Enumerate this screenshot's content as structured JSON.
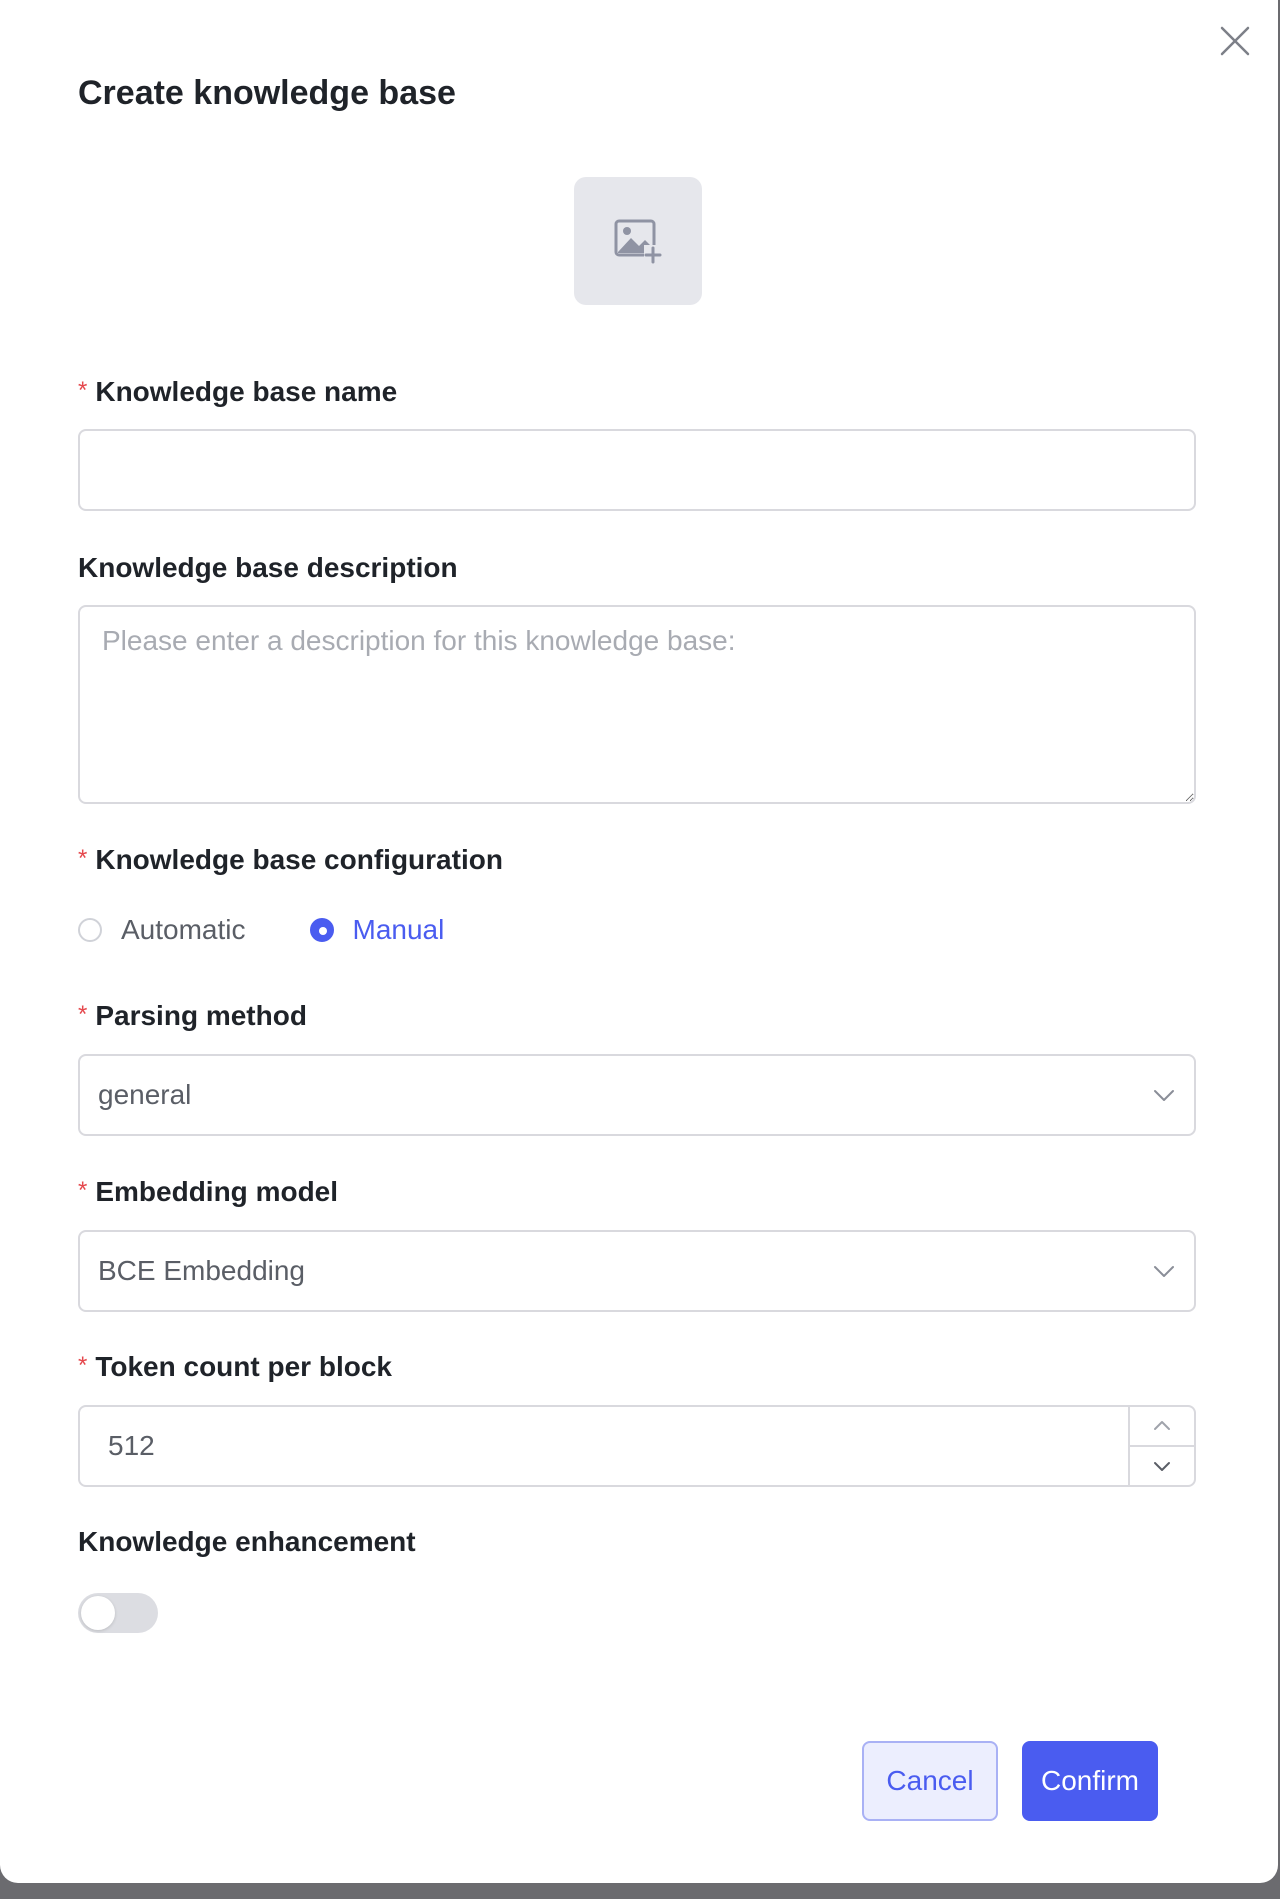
{
  "dialog": {
    "title": "Create knowledge base"
  },
  "avatar": {
    "icon": "image-add-icon"
  },
  "fields": {
    "name": {
      "label": "Knowledge base name",
      "required": true,
      "value": "",
      "placeholder": ""
    },
    "description": {
      "label": "Knowledge base description",
      "required": false,
      "placeholder": "Please enter a description for this knowledge base:"
    },
    "configuration": {
      "label": "Knowledge base configuration",
      "required": true,
      "options": [
        {
          "label": "Automatic",
          "checked": false
        },
        {
          "label": "Manual",
          "checked": true
        }
      ]
    },
    "parsing_method": {
      "label": "Parsing method",
      "required": true,
      "value": "general"
    },
    "embedding_model": {
      "label": "Embedding model",
      "required": true,
      "value": "BCE Embedding"
    },
    "token_count": {
      "label": "Token count per block",
      "required": true,
      "value": "512"
    },
    "enhancement": {
      "label": "Knowledge enhancement",
      "required": false,
      "enabled": false
    }
  },
  "footer": {
    "cancel_label": "Cancel",
    "confirm_label": "Confirm"
  },
  "colors": {
    "accent": "#4a5cf0",
    "required": "#e5484d"
  }
}
